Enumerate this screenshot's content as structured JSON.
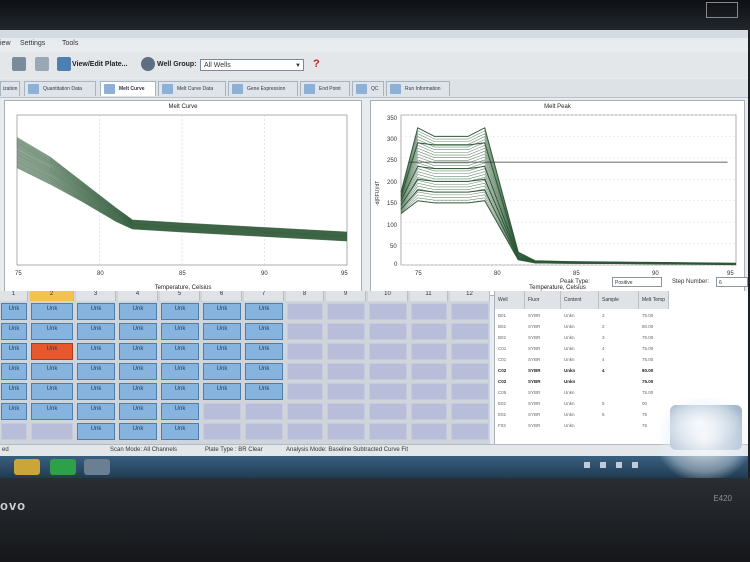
{
  "menu": {
    "view": "iew",
    "settings": "Settings",
    "tools": "Tools"
  },
  "toolbar": {
    "view_edit_plate": "View/Edit Plate...",
    "well_group_label": "Well Group:",
    "well_group_value": "All Wells",
    "help": "?"
  },
  "tabs": [
    {
      "label": "ization"
    },
    {
      "label": "Quantitation Data"
    },
    {
      "label": "Melt Curve"
    },
    {
      "label": "Melt Curve Data"
    },
    {
      "label": "Gene Expression"
    },
    {
      "label": "End Point"
    },
    {
      "label": "QC"
    },
    {
      "label": "Run Information"
    }
  ],
  "melt_curve": {
    "title": "Melt Curve",
    "xlabel": "Temperature, Celsius",
    "x_ticks": [
      "75",
      "80",
      "85",
      "90",
      "95"
    ]
  },
  "melt_peak": {
    "title": "Melt Peak",
    "xlabel": "Temperature, Celsius",
    "ylabel": "-d(RFU)/dT",
    "x_ticks": [
      "75",
      "80",
      "85",
      "90",
      "95"
    ],
    "y_ticks": [
      "350",
      "300",
      "250",
      "200",
      "150",
      "100",
      "50",
      "0"
    ]
  },
  "chart_data": [
    {
      "type": "line",
      "title": "Melt Curve",
      "xlabel": "Temperature, Celsius",
      "ylabel": "",
      "xlim": [
        75,
        95
      ],
      "series_shape": "descending sigmoid per well, plateau after ~82",
      "x": [
        75,
        77,
        79,
        81,
        82,
        85,
        90,
        95
      ],
      "series": [
        {
          "values": [
            0.85,
            0.72,
            0.55,
            0.38,
            0.3,
            0.28,
            0.25,
            0.22
          ]
        },
        {
          "values": [
            0.75,
            0.62,
            0.48,
            0.33,
            0.27,
            0.25,
            0.22,
            0.19
          ]
        },
        {
          "values": [
            0.65,
            0.54,
            0.42,
            0.29,
            0.24,
            0.22,
            0.19,
            0.16
          ]
        }
      ]
    },
    {
      "type": "line",
      "title": "Melt Peak",
      "xlabel": "Temperature, Celsius",
      "ylabel": "-d(RFU)/dT",
      "xlim": [
        75,
        95
      ],
      "ylim": [
        0,
        350
      ],
      "threshold": 240,
      "x": [
        75,
        76,
        77,
        79,
        80,
        82,
        83,
        85,
        90,
        95
      ],
      "series": [
        {
          "values": [
            170,
            320,
            300,
            300,
            320,
            30,
            10,
            8,
            6,
            4
          ]
        },
        {
          "values": [
            160,
            285,
            280,
            280,
            285,
            25,
            8,
            6,
            5,
            3
          ]
        },
        {
          "values": [
            150,
            230,
            225,
            225,
            230,
            20,
            7,
            5,
            4,
            2
          ]
        },
        {
          "values": [
            140,
            200,
            195,
            195,
            200,
            18,
            6,
            5,
            4,
            2
          ]
        },
        {
          "values": [
            130,
            175,
            170,
            170,
            175,
            15,
            5,
            4,
            3,
            2
          ]
        },
        {
          "values": [
            120,
            150,
            145,
            145,
            150,
            12,
            5,
            4,
            3,
            1
          ]
        }
      ]
    }
  ],
  "peak_controls": {
    "peak_type_label": "Peak Type:",
    "peak_type_value": "Positive",
    "step_label": "Step Number:",
    "step_value": "6"
  },
  "plate": {
    "columns": [
      "1",
      "2",
      "3",
      "4",
      "5",
      "6",
      "7",
      "8",
      "9",
      "10",
      "11",
      "12"
    ],
    "well_label": "Unk"
  },
  "table": {
    "headers": [
      "Well",
      "Fluor",
      "Content",
      "Sample",
      "Melt Temp"
    ],
    "rows": [
      [
        "B01",
        "SYBR",
        "Unkn",
        "2",
        "75.00"
      ],
      [
        "B02",
        "SYBR",
        "Unkn",
        "2",
        "80.00"
      ],
      [
        "B02",
        "SYBR",
        "Unkn",
        "3",
        "75.00"
      ],
      [
        "C01",
        "SYBR",
        "Unkn",
        "4",
        "75.00"
      ],
      [
        "C01",
        "SYBR",
        "Unkn",
        "4",
        "75.00"
      ],
      [
        "C02",
        "SYBR",
        "Unkn",
        "4",
        "80.00"
      ],
      [
        "C02",
        "SYBR",
        "Unkn",
        "",
        "75.00"
      ],
      [
        "C05",
        "SYBR",
        "Unkn",
        "",
        "75.00"
      ],
      [
        "E02",
        "SYBR",
        "Unkn",
        "5",
        "00"
      ],
      [
        "E02",
        "SYBR",
        "Unkn",
        "5",
        "75"
      ],
      [
        "F03",
        "SYBR",
        "Unkn",
        "",
        "75"
      ]
    ]
  },
  "status": {
    "left": "ed",
    "scan_mode": "Scan Mode: All Channels",
    "plate_type": "Plate Type : BR Clear",
    "analysis_mode": "Analysis Mode: Baseline Subtracted Curve Fit"
  },
  "laptop": {
    "brand": "ovo",
    "model": "E420"
  },
  "colors": {
    "curve": "#2f5a38",
    "well": "#86b4de",
    "well_selected": "#e6582e",
    "threshold": "#333333"
  }
}
